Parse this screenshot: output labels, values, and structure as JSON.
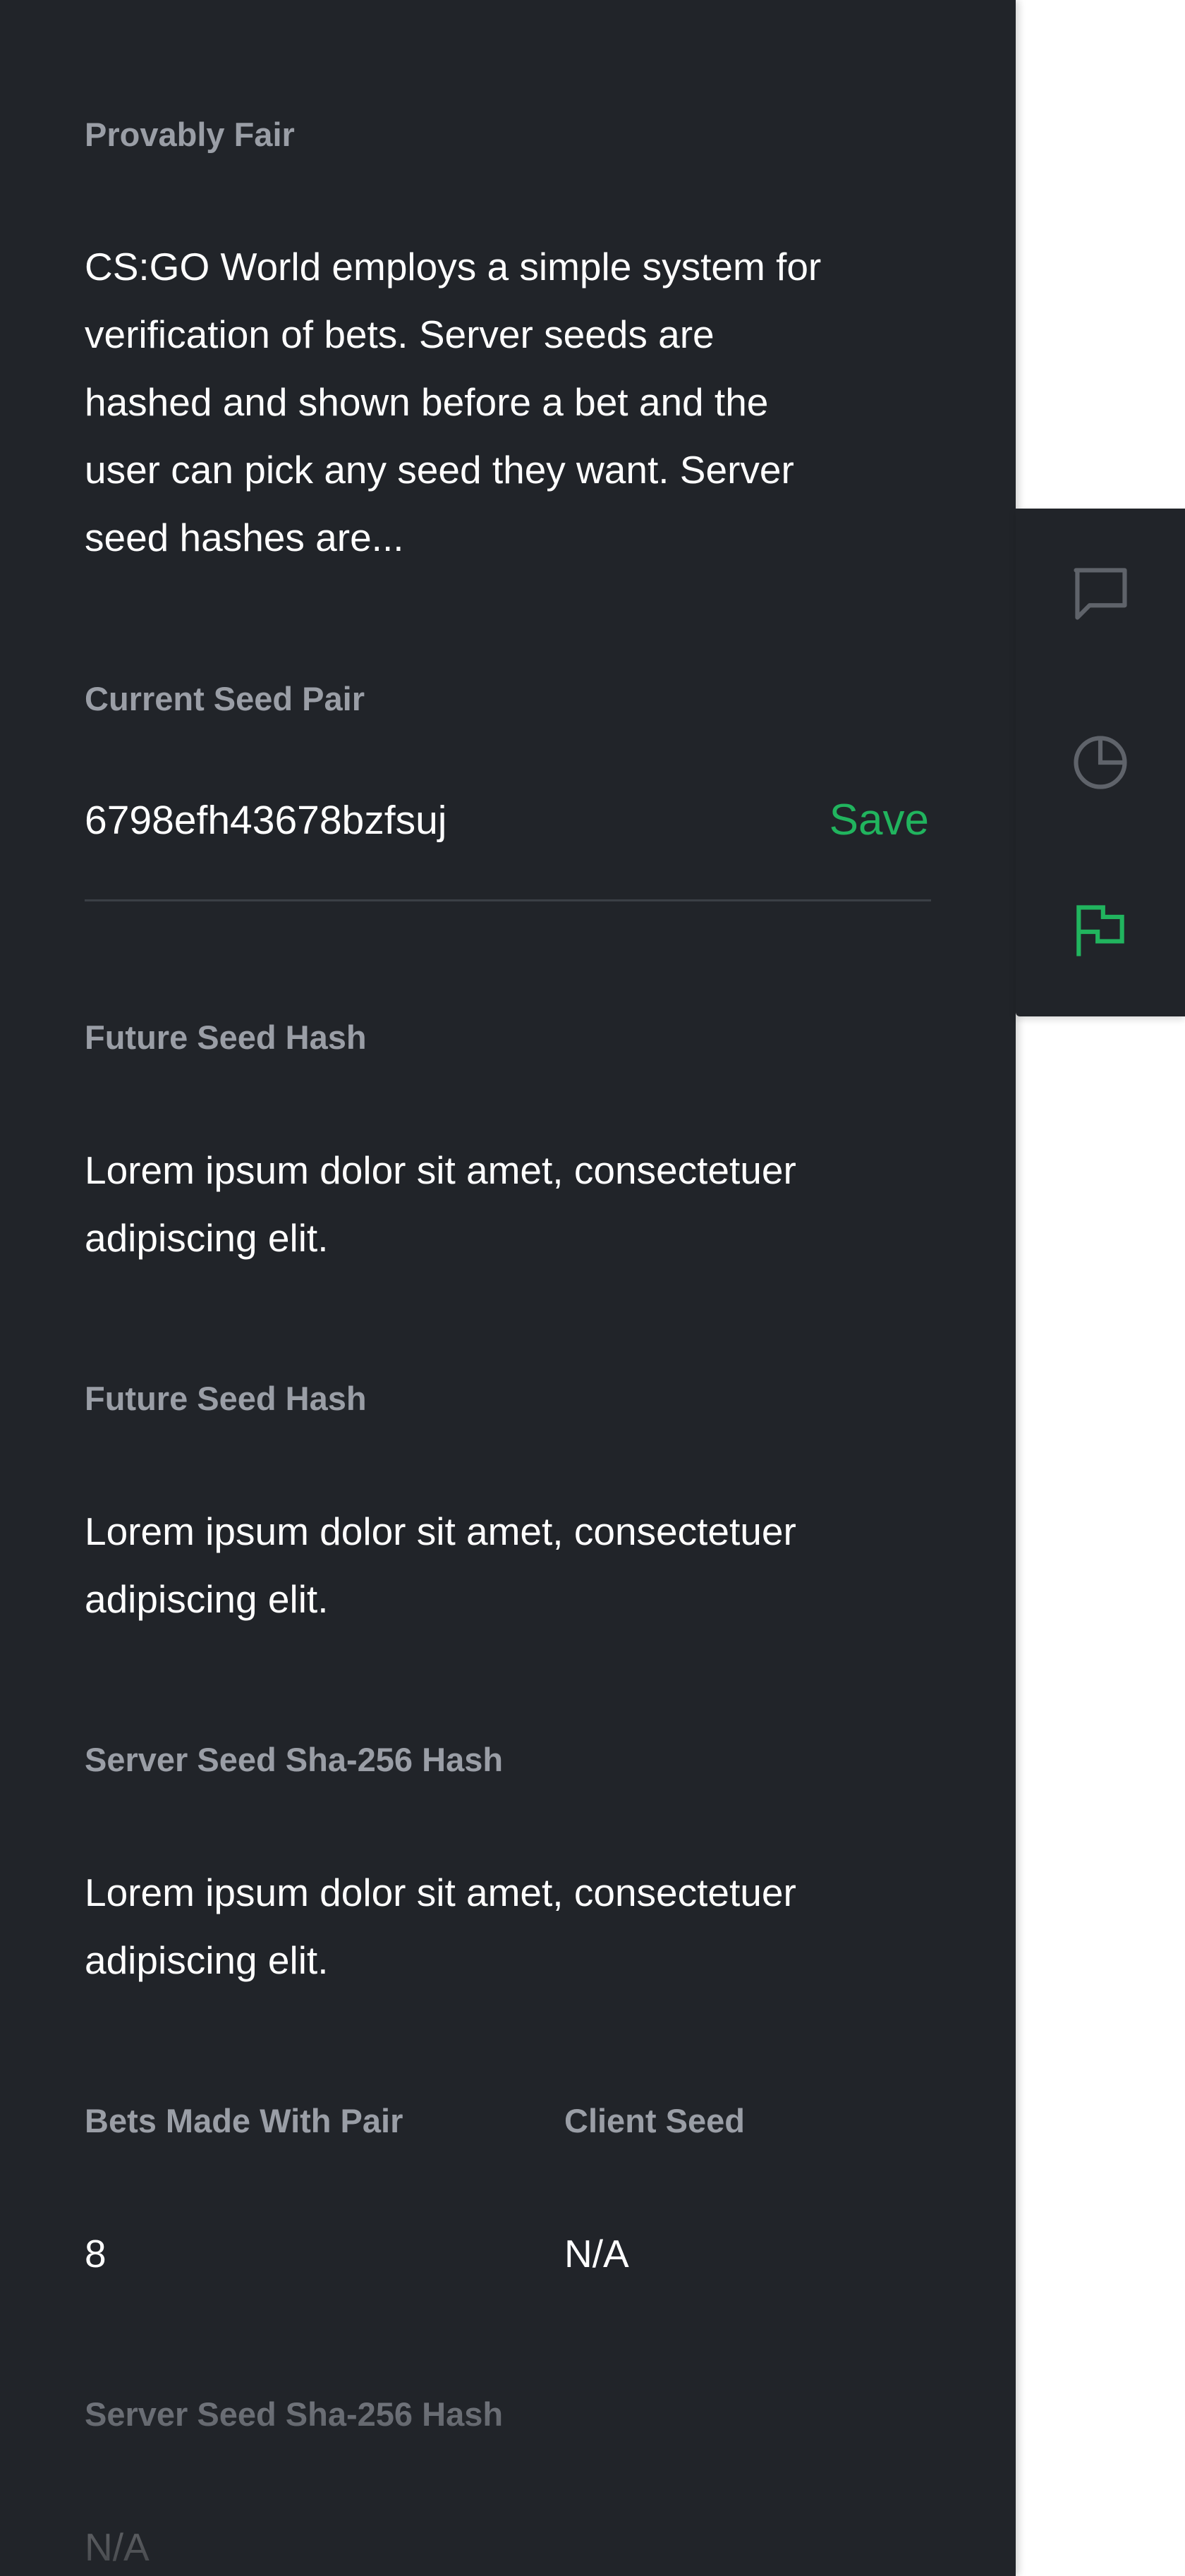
{
  "provably_fair": {
    "label": "Provably Fair",
    "description": "CS:GO World employs a simple system for verification of bets. Server seeds are hashed and shown before a bet and the user can pick any seed they want. Server seed hashes are..."
  },
  "current_seed_pair": {
    "label": "Current Seed Pair",
    "value": "6798efh43678bzfsuj",
    "save_label": "Save"
  },
  "future_seed_hash_1": {
    "label": "Future Seed Hash",
    "value": "Lorem ipsum dolor sit amet, consectetuer adipiscing elit."
  },
  "future_seed_hash_2": {
    "label": "Future Seed Hash",
    "value": "Lorem ipsum dolor sit amet, consectetuer adipiscing elit."
  },
  "server_seed_hash_1": {
    "label": "Server Seed Sha-256 Hash",
    "value": "Lorem ipsum dolor sit amet, consectetuer adipiscing elit."
  },
  "bets_made": {
    "label": "Bets Made With Pair",
    "value": "8"
  },
  "client_seed": {
    "label": "Client Seed",
    "value": "N/A"
  },
  "server_seed_hash_2": {
    "label": "Server Seed Sha-256 Hash",
    "value": "N/A"
  },
  "toolbar": {
    "items": [
      {
        "icon": "chat-bubble-icon",
        "active": false
      },
      {
        "icon": "pie-chart-icon",
        "active": false
      },
      {
        "icon": "flag-icon",
        "active": true
      }
    ],
    "active_color": "#21b45e",
    "inactive_color": "#5f636a"
  },
  "colors": {
    "panel_bg": "#212429",
    "accent": "#21b45e",
    "label": "#9a9ea6",
    "text": "#ffffff"
  }
}
